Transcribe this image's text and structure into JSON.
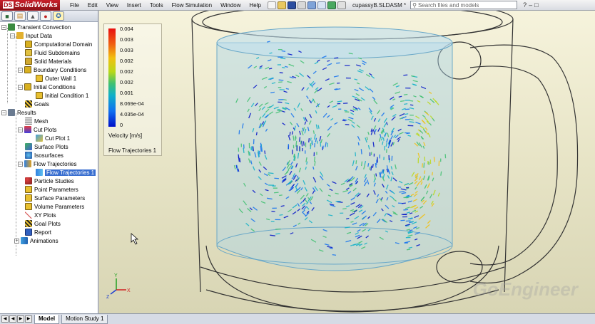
{
  "app": {
    "name": "SolidWorks",
    "brand_mark": "DS"
  },
  "menu": [
    "File",
    "Edit",
    "View",
    "Insert",
    "Tools",
    "Flow Simulation",
    "Window",
    "Help"
  ],
  "document_title": "cupassyB.SLDASM *",
  "search": {
    "placeholder": "Search files and models"
  },
  "panel_tabs": [
    "feature-manager",
    "property-manager",
    "configuration-manager",
    "display-manager",
    "flow-analysis"
  ],
  "tree": {
    "root": "Transient Convection",
    "input_data": "Input Data",
    "computational_domain": "Computational Domain",
    "fluid_subdomains": "Fluid Subdomains",
    "solid_materials": "Solid Materials",
    "boundary_conditions": "Boundary Conditions",
    "outer_wall": "Outer Wall 1",
    "initial_conditions": "Initial Conditions",
    "initial_condition": "Initial Condition 1",
    "goals": "Goals",
    "results": "Results",
    "mesh": "Mesh",
    "cut_plots": "Cut Plots",
    "cut_plot": "Cut Plot 1",
    "surface_plots": "Surface Plots",
    "isosurfaces": "Isosurfaces",
    "flow_trajectories": "Flow Trajectories",
    "flow_trajectory": "Flow Trajectories 1",
    "particle_studies": "Particle Studies",
    "point_parameters": "Point Parameters",
    "surface_parameters": "Surface Parameters",
    "volume_parameters": "Volume Parameters",
    "xy_plots": "XY Plots",
    "goal_plots": "Goal Plots",
    "report": "Report",
    "animations": "Animations"
  },
  "legend": {
    "ticks": [
      "0.004",
      "0.003",
      "0.003",
      "0.002",
      "0.002",
      "0.002",
      "0.001",
      "8.069e-04",
      "4.035e-04",
      "0"
    ],
    "units": "Velocity [m/s]",
    "plot_name": "Flow Trajectories 1",
    "colors": [
      "#e81010",
      "#f06010",
      "#f2c010",
      "#b8d818",
      "#40c070",
      "#10b0c8",
      "#1070f0",
      "#0010c8"
    ]
  },
  "watermark": "GoEngineer",
  "bottom_tabs": [
    "Model",
    "Motion Study 1"
  ],
  "colors": {
    "viewport_bg": "#e7e4c6",
    "selection": "#3a6fd0",
    "brand_red": "#c8202a"
  }
}
